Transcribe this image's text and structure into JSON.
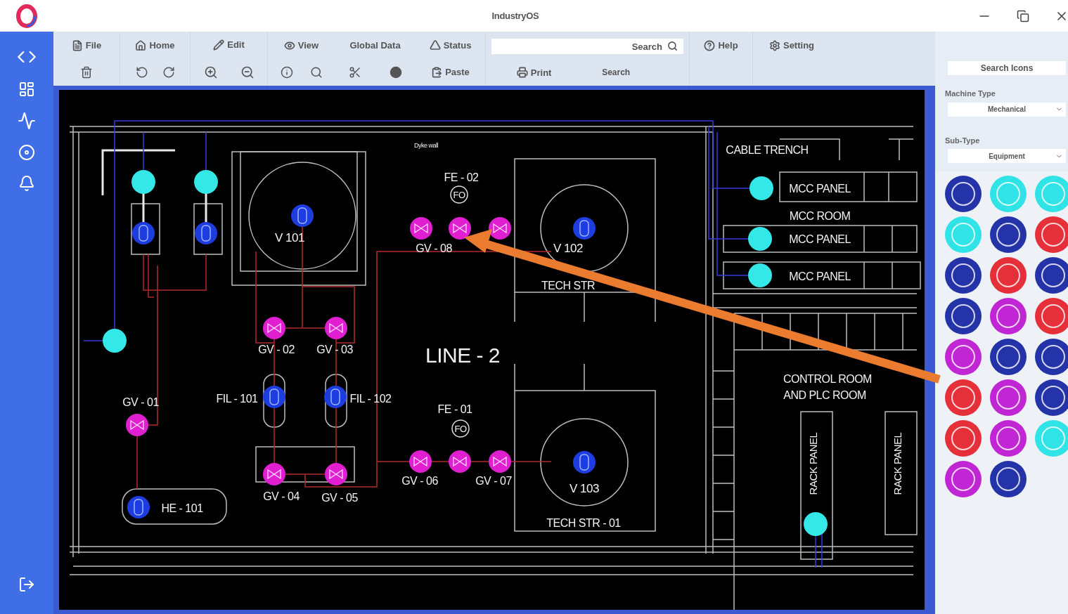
{
  "title_bar": {
    "title": "IndustryOS"
  },
  "toolbar": {
    "menus": [
      {
        "label": "File"
      },
      {
        "label": "Home"
      },
      {
        "label": "Edit"
      },
      {
        "label": "View"
      },
      {
        "label": "Global Data"
      },
      {
        "label": "Status"
      }
    ],
    "search": {
      "placeholder": "Search"
    },
    "help": "Help",
    "setting": "Setting",
    "paste": "Paste",
    "print": "Print",
    "search_button": "Search"
  },
  "diagram": {
    "labels": [
      "Dyke wall",
      "FE - 02",
      "FO",
      "V 101",
      "GV - 08",
      "V 102",
      "TECH STR",
      "CABLE TRENCH",
      "MCC PANEL",
      "MCC ROOM",
      "MCC PANEL",
      "MCC PANEL",
      "GV - 02",
      "GV - 03",
      "LINE - 2",
      "GV - 01",
      "FIL - 101",
      "FIL - 102",
      "FE - 01",
      "FO",
      "CONTROL ROOM",
      "AND PLC ROOM",
      "GV - 06",
      "GV - 07",
      "V 103",
      "GV - 04",
      "GV - 05",
      "HE - 101",
      "TECH STR - 01",
      "RACK PANEL",
      "RACK PANEL"
    ]
  },
  "right_panel": {
    "search": {
      "placeholder": "Search Icons"
    },
    "machine_type": {
      "label": "Machine Type",
      "value": "Mechanical"
    },
    "sub_type": {
      "label": "Sub-Type",
      "value": "Equipment"
    },
    "palette": [
      {
        "color": "#2434a8"
      },
      {
        "color": "#2fe3e6"
      },
      {
        "color": "#2fe3e6"
      },
      {
        "color": "#2fe3e6"
      },
      {
        "color": "#2434a8"
      },
      {
        "color": "#e5303a"
      },
      {
        "color": "#2434a8"
      },
      {
        "color": "#e5303a"
      },
      {
        "color": "#2434a8"
      },
      {
        "color": "#2434a8"
      },
      {
        "color": "#c026d3"
      },
      {
        "color": "#e5303a"
      },
      {
        "color": "#c026d3"
      },
      {
        "color": "#2434a8"
      },
      {
        "color": "#2434a8"
      },
      {
        "color": "#e5303a"
      },
      {
        "color": "#c026d3"
      },
      {
        "color": "#2434a8"
      },
      {
        "color": "#e5303a"
      },
      {
        "color": "#c026d3"
      },
      {
        "color": "#2fe3e6"
      },
      {
        "color": "#c026d3"
      },
      {
        "color": "#2434a8"
      }
    ]
  }
}
